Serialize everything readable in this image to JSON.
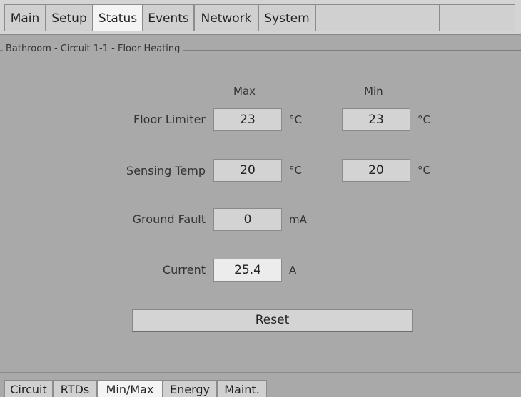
{
  "top_tabs": [
    {
      "label": "Main",
      "active": false
    },
    {
      "label": "Setup",
      "active": false
    },
    {
      "label": "Status",
      "active": true
    },
    {
      "label": "Events",
      "active": false
    },
    {
      "label": "Network",
      "active": false
    },
    {
      "label": "System",
      "active": false
    }
  ],
  "group": {
    "title": "Bathroom - Circuit 1-1 - Floor Heating"
  },
  "columns": {
    "max": "Max",
    "min": "Min"
  },
  "rows": {
    "floor_limiter": {
      "label": "Floor Limiter",
      "max": "23",
      "max_unit": "°C",
      "min": "23",
      "min_unit": "°C"
    },
    "sensing_temp": {
      "label": "Sensing Temp",
      "max": "20",
      "max_unit": "°C",
      "min": "20",
      "min_unit": "°C"
    },
    "ground_fault": {
      "label": "Ground Fault",
      "value": "0",
      "unit": "mA"
    },
    "current": {
      "label": "Current",
      "value": "25.4",
      "unit": "A"
    }
  },
  "reset_label": "Reset",
  "bottom_tabs": [
    {
      "label": "Circuit",
      "active": false
    },
    {
      "label": "RTDs",
      "active": false
    },
    {
      "label": "Min/Max",
      "active": true
    },
    {
      "label": "Energy",
      "active": false
    },
    {
      "label": "Maint.",
      "active": false
    }
  ],
  "colors": {
    "background": "#a9a9a9",
    "tab_active": "#f4f4f4",
    "tab_inactive": "#d0d0d0"
  }
}
